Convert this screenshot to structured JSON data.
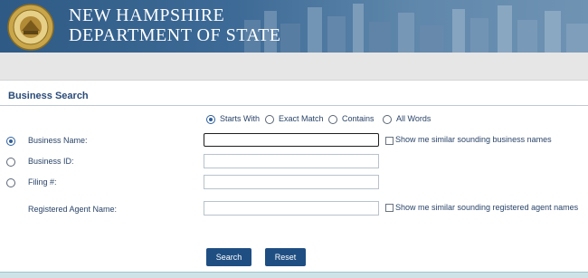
{
  "header": {
    "line1": "NEW HAMPSHIRE",
    "line2": "DEPARTMENT OF STATE"
  },
  "search": {
    "title": "Business Search",
    "match_options": [
      {
        "label": "Starts With",
        "selected": true
      },
      {
        "label": "Exact Match",
        "selected": false
      },
      {
        "label": "Contains",
        "selected": false
      },
      {
        "label": "All Words",
        "selected": false
      }
    ],
    "fields": {
      "business_name": {
        "label": "Business Name:",
        "value": "",
        "selected": true
      },
      "business_id": {
        "label": "Business ID:",
        "value": "",
        "selected": false
      },
      "filing": {
        "label": "Filing #:",
        "value": "",
        "selected": false
      },
      "agent_name": {
        "label": "Registered Agent Name:",
        "value": ""
      }
    },
    "similar_business": "Show me similar sounding business names",
    "similar_agent": "Show me similar sounding registered agent names",
    "search_button": "Search",
    "reset_button": "Reset"
  }
}
